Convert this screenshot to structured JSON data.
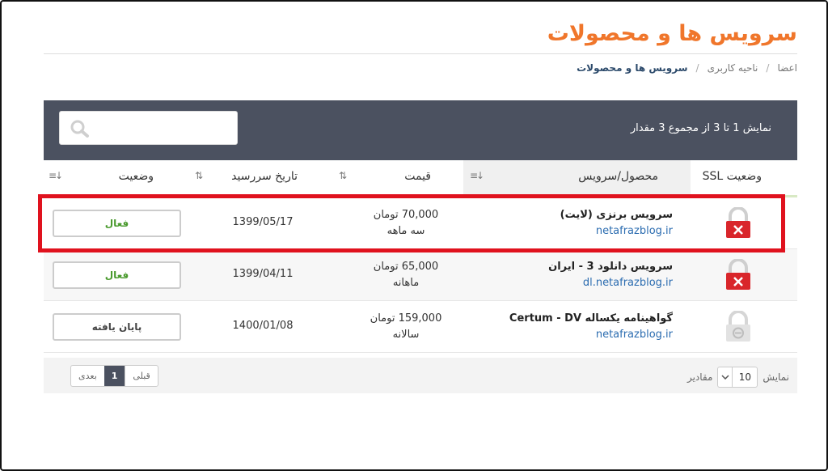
{
  "page": {
    "title": "سرویس ها و محصولات"
  },
  "breadcrumb": {
    "items": [
      "اعضا",
      "ناحیه کاربری",
      "سرویس ها و محصولات"
    ],
    "separator": "/"
  },
  "table": {
    "summary": "نمایش 1 تا 3 از مجموع 3 مقدار",
    "search_placeholder": "",
    "columns": {
      "ssl": "وضعیت SSL",
      "product": "محصول/سرویس",
      "price": "قیمت",
      "due": "تاریخ سررسید",
      "status": "وضعیت"
    },
    "sort_icon": "⇅",
    "rows": [
      {
        "product": "سرویس برنزی (لایت)",
        "domain": "netafrazblog.ir",
        "price": "70,000 تومان",
        "cycle": "سه ماهه",
        "due": "1399/05/17",
        "status": "فعال",
        "ssl": "invalid"
      },
      {
        "product": "سرویس دانلود 3 - ایران",
        "domain": "dl.netafrazblog.ir",
        "price": "65,000 تومان",
        "cycle": "ماهانه",
        "due": "1399/04/11",
        "status": "فعال",
        "ssl": "invalid"
      },
      {
        "product": "گواهینامه یکساله Certum - DV",
        "domain": "netafrazblog.ir",
        "price": "159,000 تومان",
        "cycle": "سالانه",
        "due": "1400/01/08",
        "status": "پایان یافته",
        "ssl": "none"
      }
    ]
  },
  "footer": {
    "show_label": "نمایش",
    "show_value": "10",
    "show_suffix": "مقادیر",
    "pager": {
      "prev": "قبلی",
      "current": "1",
      "next": "بعدی"
    }
  },
  "colors": {
    "title": "#f0762b",
    "header_bar": "#4b5160",
    "accent_green": "#8fc54f",
    "highlight": "#e0121e",
    "ssl_invalid": "#d9262b"
  }
}
